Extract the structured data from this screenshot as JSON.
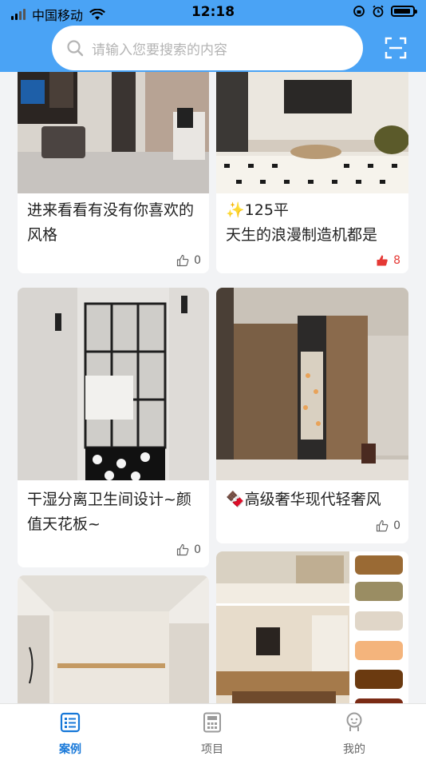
{
  "status": {
    "carrier": "中国移动",
    "time": "12:18"
  },
  "search": {
    "placeholder": "请输入您要搜索的内容"
  },
  "cards": [
    {
      "title": "进来看看有没有你喜欢的风格",
      "likes": "0",
      "liked": false
    },
    {
      "title": "✨125平\n天生的浪漫制造机都是",
      "likes": "8",
      "liked": true
    },
    {
      "title": "干湿分离卫生间设计~颜值天花板~",
      "likes": "0",
      "liked": false
    },
    {
      "title": "🍫高级奢华现代轻奢风",
      "likes": "0",
      "liked": false
    }
  ],
  "palette": [
    "#9a6a34",
    "#9a8d63",
    "#e0d6c8",
    "#f4b47c",
    "#6b3a10",
    "#7a2a14"
  ],
  "tabs": [
    {
      "label": "案例",
      "icon": "list-icon",
      "active": true
    },
    {
      "label": "项目",
      "icon": "calculator-icon",
      "active": false
    },
    {
      "label": "我的",
      "icon": "user-icon",
      "active": false
    }
  ],
  "colors": {
    "header": "#4aa3f5",
    "accent": "#1677d8",
    "like_active": "#e53935"
  }
}
